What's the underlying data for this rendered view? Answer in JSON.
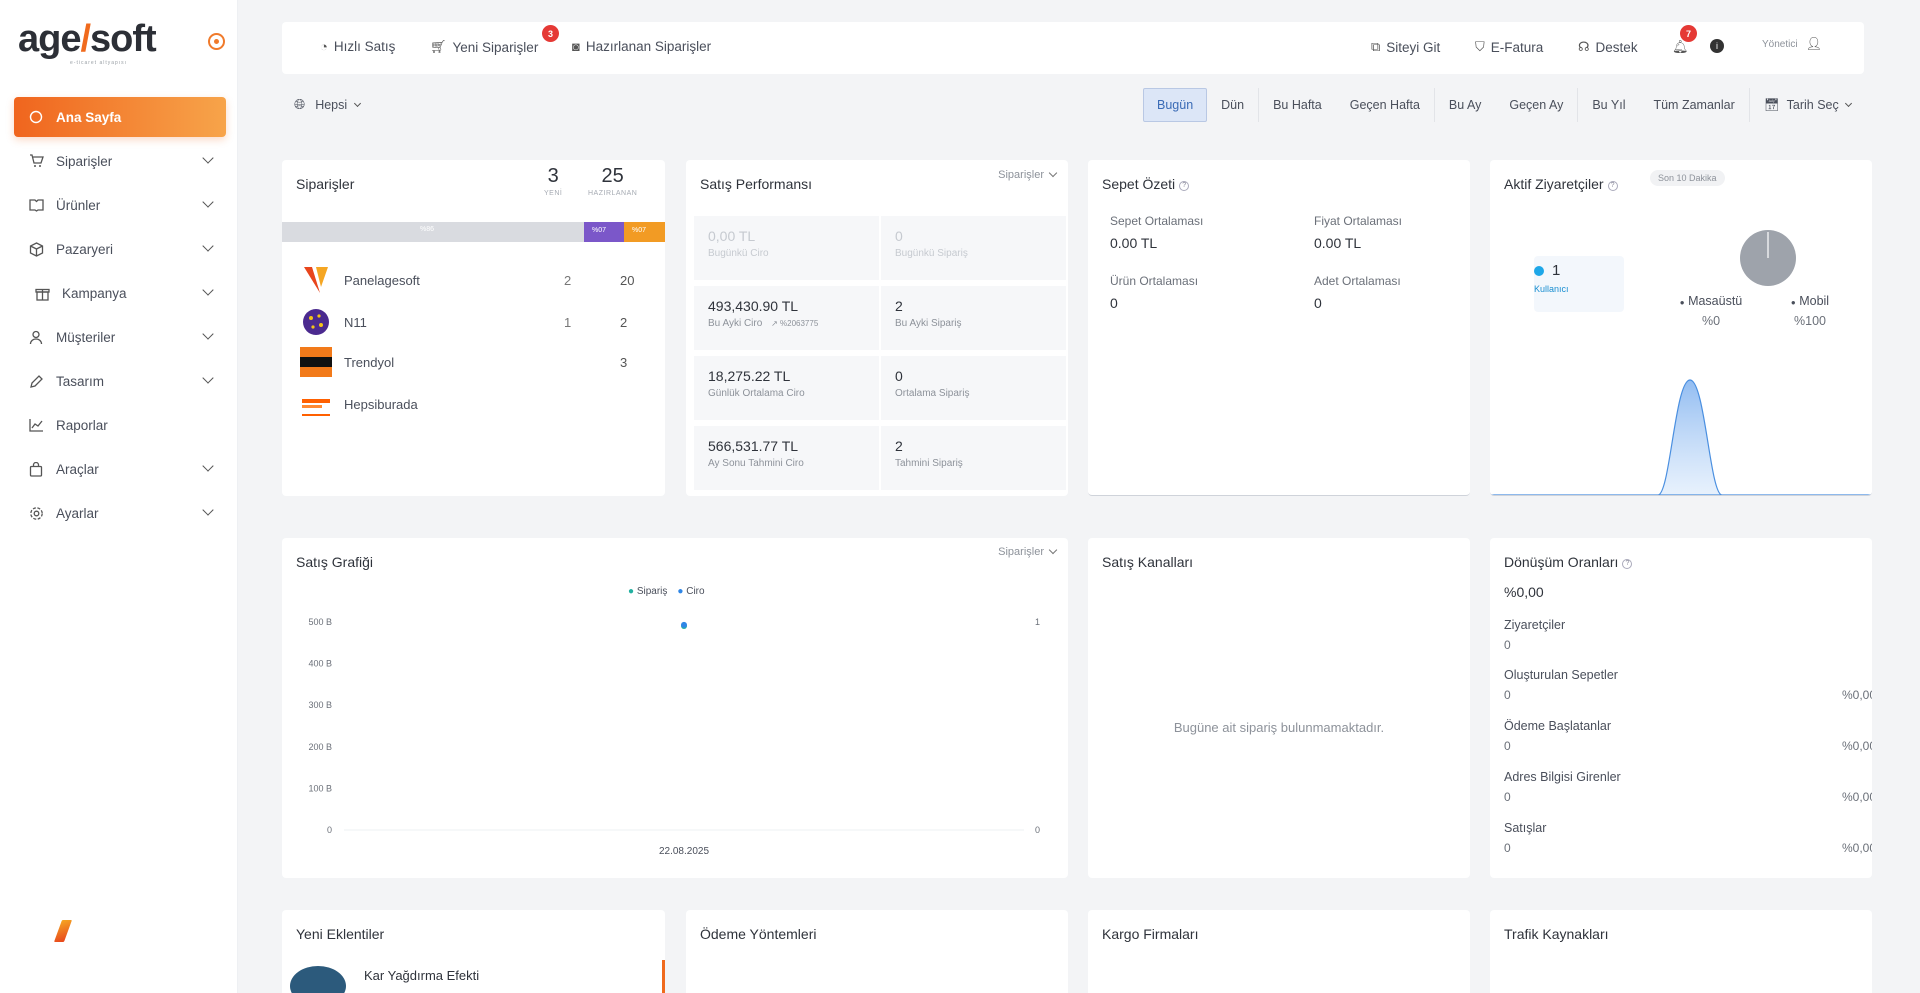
{
  "brand": {
    "logo_left": "age",
    "logo_right": "soft",
    "tagline": "e-ticaret altyapısı",
    "accent": "#f06a1d"
  },
  "sidebar": {
    "items": [
      {
        "label": "Ana Sayfa",
        "icon": "home-icon",
        "active": true
      },
      {
        "label": "Siparişler",
        "icon": "cart-icon"
      },
      {
        "label": "Ürünler",
        "icon": "book-icon"
      },
      {
        "label": "Pazaryeri",
        "icon": "box-icon"
      },
      {
        "label": "Kampanya",
        "icon": "gift-icon"
      },
      {
        "label": "Müşteriler",
        "icon": "user-icon"
      },
      {
        "label": "Tasarım",
        "icon": "pen-icon"
      },
      {
        "label": "Raporlar",
        "icon": "chart-icon"
      },
      {
        "label": "Araçlar",
        "icon": "bag-icon"
      },
      {
        "label": "Ayarlar",
        "icon": "gear-icon"
      }
    ]
  },
  "topbar": {
    "quick_sale": "Hızlı Satış",
    "new_orders": "Yeni Siparişler",
    "new_orders_badge": "3",
    "prepared_orders": "Hazırlanan Siparişler",
    "visit_site": "Siteyi Git",
    "einvoice": "E-Fatura",
    "support": "Destek",
    "notif_badge": "7",
    "user": "Yönetici"
  },
  "filters": {
    "scope": "Hepsi",
    "ranges": [
      "Bugün",
      "Dün",
      "Bu Hafta",
      "Geçen Hafta",
      "Bu Ay",
      "Geçen Ay",
      "Bu Yıl",
      "Tüm Zamanlar"
    ],
    "active": "Bugün",
    "date_pick": "Tarih Seç"
  },
  "orders": {
    "title": "Siparişler",
    "new_count": "3",
    "new_label": "YENİ",
    "prep_count": "25",
    "prep_label": "HAZIRLANAN",
    "bar_grey": "%86",
    "bar_purple": "%07",
    "bar_orange": "%07",
    "channels": [
      {
        "name": "Panelagesoft",
        "a": "2",
        "b": "20"
      },
      {
        "name": "N11",
        "a": "1",
        "b": "2"
      },
      {
        "name": "Trendyol",
        "a": "",
        "b": "3"
      },
      {
        "name": "Hepsiburada",
        "a": "",
        "b": ""
      }
    ]
  },
  "performance": {
    "title": "Satış Performansı",
    "dropdown": "Siparişler",
    "boxes": [
      {
        "v": "0,00 TL",
        "l": "Bugünkü Ciro",
        "faded": true
      },
      {
        "v": "0",
        "l": "Bugünkü Sipariş",
        "faded": true
      },
      {
        "v": "493,430.90 TL",
        "l": "Bu Ayki Ciro",
        "extra": "%2063775"
      },
      {
        "v": "2",
        "l": "Bu Ayki Sipariş"
      },
      {
        "v": "18,275.22 TL",
        "l": "Günlük Ortalama Ciro"
      },
      {
        "v": "0",
        "l": "Ortalama Sipariş"
      },
      {
        "v": "566,531.77 TL",
        "l": "Ay Sonu Tahmini Ciro"
      },
      {
        "v": "2",
        "l": "Tahmini Sipariş"
      }
    ]
  },
  "basket": {
    "title": "Sepet Özeti",
    "items": [
      {
        "k": "Sepet Ortalaması",
        "v": "0.00 TL"
      },
      {
        "k": "Fiyat Ortalaması",
        "v": "0.00 TL"
      },
      {
        "k": "Ürün Ortalaması",
        "v": "0"
      },
      {
        "k": "Adet Ortalaması",
        "v": "0"
      }
    ]
  },
  "visitors": {
    "title": "Aktif Ziyaretçiler",
    "period": "Son 10 Dakika",
    "count": "1",
    "count_label": "Kullanıcı",
    "desktop_label": "Masaüstü",
    "desktop_pct": "%0",
    "mobile_label": "Mobil",
    "mobile_pct": "%100"
  },
  "sales_chart": {
    "title": "Satış Grafiği",
    "dropdown": "Siparişler",
    "legend_orders": "Sipariş",
    "legend_revenue": "Ciro"
  },
  "chart_data": {
    "type": "line",
    "categories": [
      "22.08.2025"
    ],
    "series": [
      {
        "name": "Sipariş",
        "values": [
          1
        ],
        "color": "#22b0a0"
      },
      {
        "name": "Ciro",
        "values": [
          493
        ],
        "color": "#2f86e6"
      }
    ],
    "y_left_ticks": [
      "500 B",
      "400 B",
      "300 B",
      "200 B",
      "100 B",
      "0"
    ],
    "y_right_ticks": [
      "1",
      "0"
    ],
    "ylim_left": [
      0,
      500
    ],
    "ylim_right": [
      0,
      1
    ],
    "legend": "top-center"
  },
  "channels_card": {
    "title": "Satış Kanalları",
    "empty": "Bugüne ait sipariş bulunmamaktadır."
  },
  "conversion": {
    "title": "Dönüşüm Oranları",
    "total": "%0,00",
    "rows": [
      {
        "k": "Ziyaretçiler",
        "v": "0",
        "p": ""
      },
      {
        "k": "Oluşturulan Sepetler",
        "v": "0",
        "p": "%0,00"
      },
      {
        "k": "Ödeme Başlatanlar",
        "v": "0",
        "p": "%0,00"
      },
      {
        "k": "Adres Bilgisi Girenler",
        "v": "0",
        "p": "%0,00"
      },
      {
        "k": "Satışlar",
        "v": "0",
        "p": "%0,00"
      }
    ]
  },
  "bottom_cards": {
    "new_plugins": "Yeni Eklentiler",
    "plugin_name": "Kar Yağdırma Efekti",
    "payment_methods": "Ödeme Yöntemleri",
    "cargo": "Kargo Firmaları",
    "traffic": "Trafik Kaynakları"
  }
}
